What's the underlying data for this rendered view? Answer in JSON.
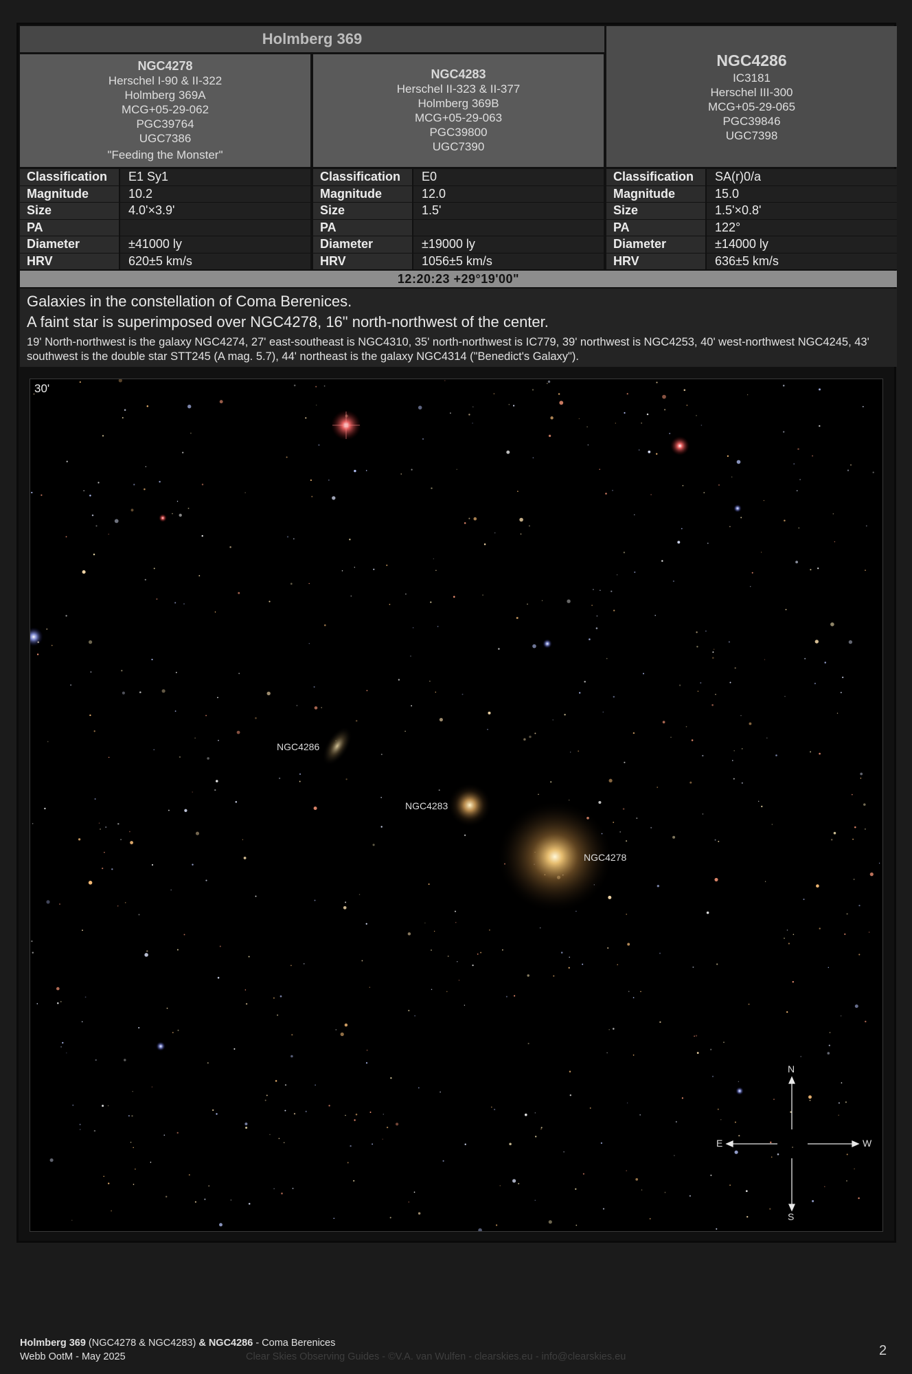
{
  "group_title": "Holmberg 369",
  "objects": [
    {
      "name": "NGC4278",
      "aliases": [
        "Herschel I-90 & II-322",
        "Holmberg 369A",
        "MCG+05-29-062",
        "PGC39764",
        "UGC7386",
        "\"Feeding the Monster\""
      ],
      "props": [
        {
          "k": "Classification",
          "v": "E1 Sy1"
        },
        {
          "k": "Magnitude",
          "v": "10.2"
        },
        {
          "k": "Size",
          "v": "4.0'×3.9'"
        },
        {
          "k": "PA",
          "v": ""
        },
        {
          "k": "Diameter",
          "v": "±41000 ly"
        },
        {
          "k": "HRV",
          "v": "620±5 km/s"
        }
      ]
    },
    {
      "name": "NGC4283",
      "aliases": [
        "Herschel II-323 & II-377",
        "Holmberg 369B",
        "MCG+05-29-063",
        "PGC39800",
        "UGC7390"
      ],
      "props": [
        {
          "k": "Classification",
          "v": "E0"
        },
        {
          "k": "Magnitude",
          "v": "12.0"
        },
        {
          "k": "Size",
          "v": "1.5'"
        },
        {
          "k": "PA",
          "v": ""
        },
        {
          "k": "Diameter",
          "v": "±19000 ly"
        },
        {
          "k": "HRV",
          "v": "1056±5 km/s"
        }
      ]
    },
    {
      "name": "NGC4286",
      "aliases": [
        "IC3181",
        "Herschel III-300",
        "MCG+05-29-065",
        "PGC39846",
        "UGC7398"
      ],
      "props": [
        {
          "k": "Classification",
          "v": "SA(r)0/a"
        },
        {
          "k": "Magnitude",
          "v": "15.0"
        },
        {
          "k": "Size",
          "v": "1.5'×0.8'"
        },
        {
          "k": "PA",
          "v": "122°"
        },
        {
          "k": "Diameter",
          "v": "±14000 ly"
        },
        {
          "k": "HRV",
          "v": "636±5 km/s"
        }
      ]
    }
  ],
  "coordinates": "12:20:23 +29°19'00\"",
  "description": {
    "line1": "Galaxies in the constellation of Coma Berenices.",
    "line2": "A faint star is superimposed over NGC4278, 16\" north-northwest of the center.",
    "line3": "19' North-northwest is the galaxy NGC4274, 27' east-southeast is NGC4310, 35' north-northwest is IC779, 39' northwest is NGC4253, 40' west-northwest NGC4245, 43' southwest is the double star STT245 (A mag. 5.7), 44' northeast is the galaxy NGC4314 (\"Benedict's Galaxy\")."
  },
  "image": {
    "scale_label": "30'",
    "labels": {
      "ngc4286": "NGC4286",
      "ngc4283": "NGC4283",
      "ngc4278": "NGC4278"
    },
    "compass": {
      "n": "N",
      "e": "E",
      "w": "W",
      "s": "S"
    }
  },
  "footer": {
    "title_bold1": "Holmberg 369",
    "title_mid": " (NGC4278 & NGC4283) ",
    "title_amp": "& ",
    "title_bold2": "NGC4286",
    "title_tail": " - Coma Berenices",
    "subtitle": "Webb OotM - May 2025",
    "credits": "Clear Skies Observing Guides - ©V.A. van Wulfen - clearskies.eu - info@clearskies.eu",
    "page": "2"
  }
}
